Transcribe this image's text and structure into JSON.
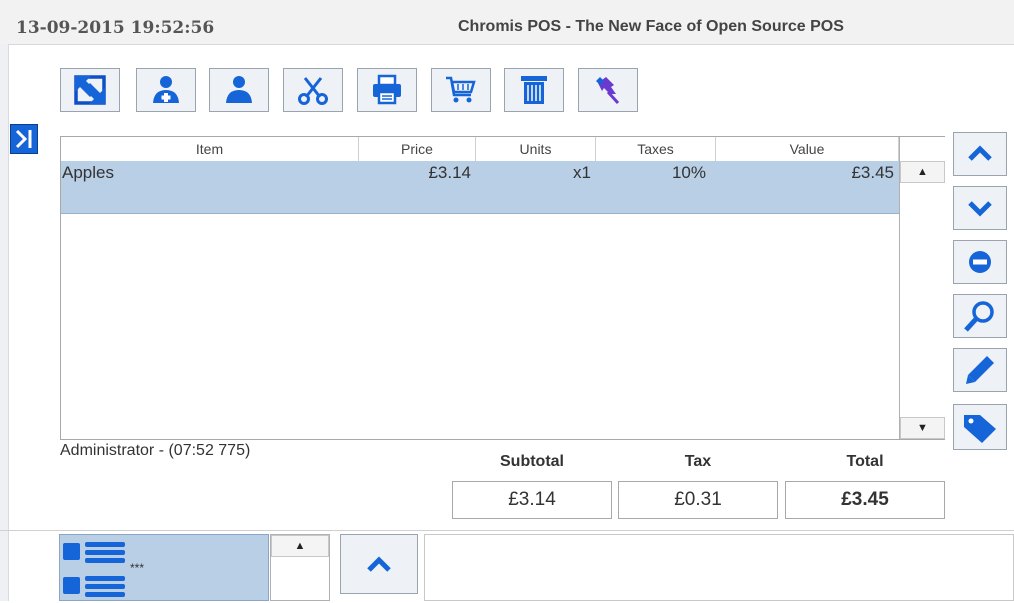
{
  "header": {
    "datetime": "13-09-2015 19:52:56",
    "title": "Chromis POS - The New Face of Open Source POS"
  },
  "toolbar": {
    "buttons": [
      {
        "icon": "switch-icon"
      },
      {
        "icon": "add-customer-icon"
      },
      {
        "icon": "customer-icon"
      },
      {
        "icon": "scissors-icon"
      },
      {
        "icon": "printer-icon"
      },
      {
        "icon": "cart-icon"
      },
      {
        "icon": "trash-icon"
      },
      {
        "icon": "pin-icon"
      }
    ]
  },
  "ticket": {
    "columns": [
      "Item",
      "Price",
      "Units",
      "Taxes",
      "Value"
    ],
    "rows": [
      {
        "item": "Apples",
        "price": "£3.14",
        "units": "x1",
        "taxes": "10%",
        "value": "£3.45",
        "selected": true
      }
    ]
  },
  "side_buttons": [
    {
      "icon": "chevron-up-icon"
    },
    {
      "icon": "chevron-down-icon"
    },
    {
      "icon": "minus-circle-icon"
    },
    {
      "icon": "search-icon"
    },
    {
      "icon": "pencil-icon"
    },
    {
      "icon": "tag-icon"
    }
  ],
  "status": {
    "user": "Administrator - (07:52 775)"
  },
  "totals": {
    "subtotal_label": "Subtotal",
    "tax_label": "Tax",
    "total_label": "Total",
    "subtotal": "£3.14",
    "tax": "£0.31",
    "total": "£3.45"
  },
  "categories": {
    "items": [
      {
        "label": "***"
      }
    ]
  },
  "colors": {
    "accent": "#1565d8",
    "selection": "#b8cfe6"
  }
}
